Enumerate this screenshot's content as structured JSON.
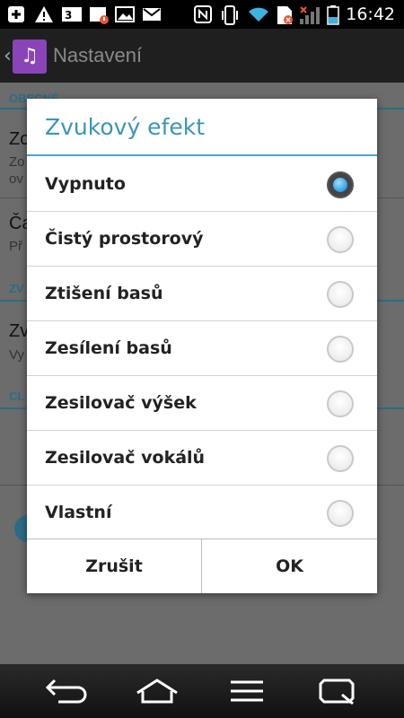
{
  "status_bar": {
    "time": "16:42",
    "icons": [
      "add-icon",
      "warning-icon",
      "3g-icon",
      "calendar-alert-icon",
      "image-icon",
      "gmail-icon",
      "nfc-icon",
      "vibrate-icon",
      "wifi-icon",
      "sim-icon",
      "signal-icon",
      "battery-icon"
    ]
  },
  "app_bar": {
    "title": "Nastavení",
    "icon": "music-icon"
  },
  "background": {
    "sections": [
      {
        "header": "OBECNÉ"
      },
      {
        "header": "ZV"
      },
      {
        "header": "CL"
      }
    ],
    "items": [
      {
        "title": "Zo",
        "subtitle": "Zo"
      },
      {
        "subtitle2": "ov"
      },
      {
        "title": "Ča",
        "subtitle": "Př"
      },
      {
        "title": "Zv",
        "subtitle": "Vy"
      }
    ]
  },
  "dialog": {
    "title": "Zvukový efekt",
    "options": [
      {
        "label": "Vypnuto",
        "selected": true
      },
      {
        "label": "Čistý prostorový",
        "selected": false
      },
      {
        "label": "Ztišení basů",
        "selected": false
      },
      {
        "label": "Zesílení basů",
        "selected": false
      },
      {
        "label": "Zesilovač výšek",
        "selected": false
      },
      {
        "label": "Zesilovač vokálů",
        "selected": false
      },
      {
        "label": "Vlastní",
        "selected": false
      }
    ],
    "cancel_label": "Zrušit",
    "ok_label": "OK"
  },
  "nav_bar": {
    "buttons": [
      "back-icon",
      "home-icon",
      "menu-icon",
      "recent-apps-icon"
    ]
  },
  "colors": {
    "accent": "#3a95b8",
    "radio_selected": "#3aa7e8"
  }
}
